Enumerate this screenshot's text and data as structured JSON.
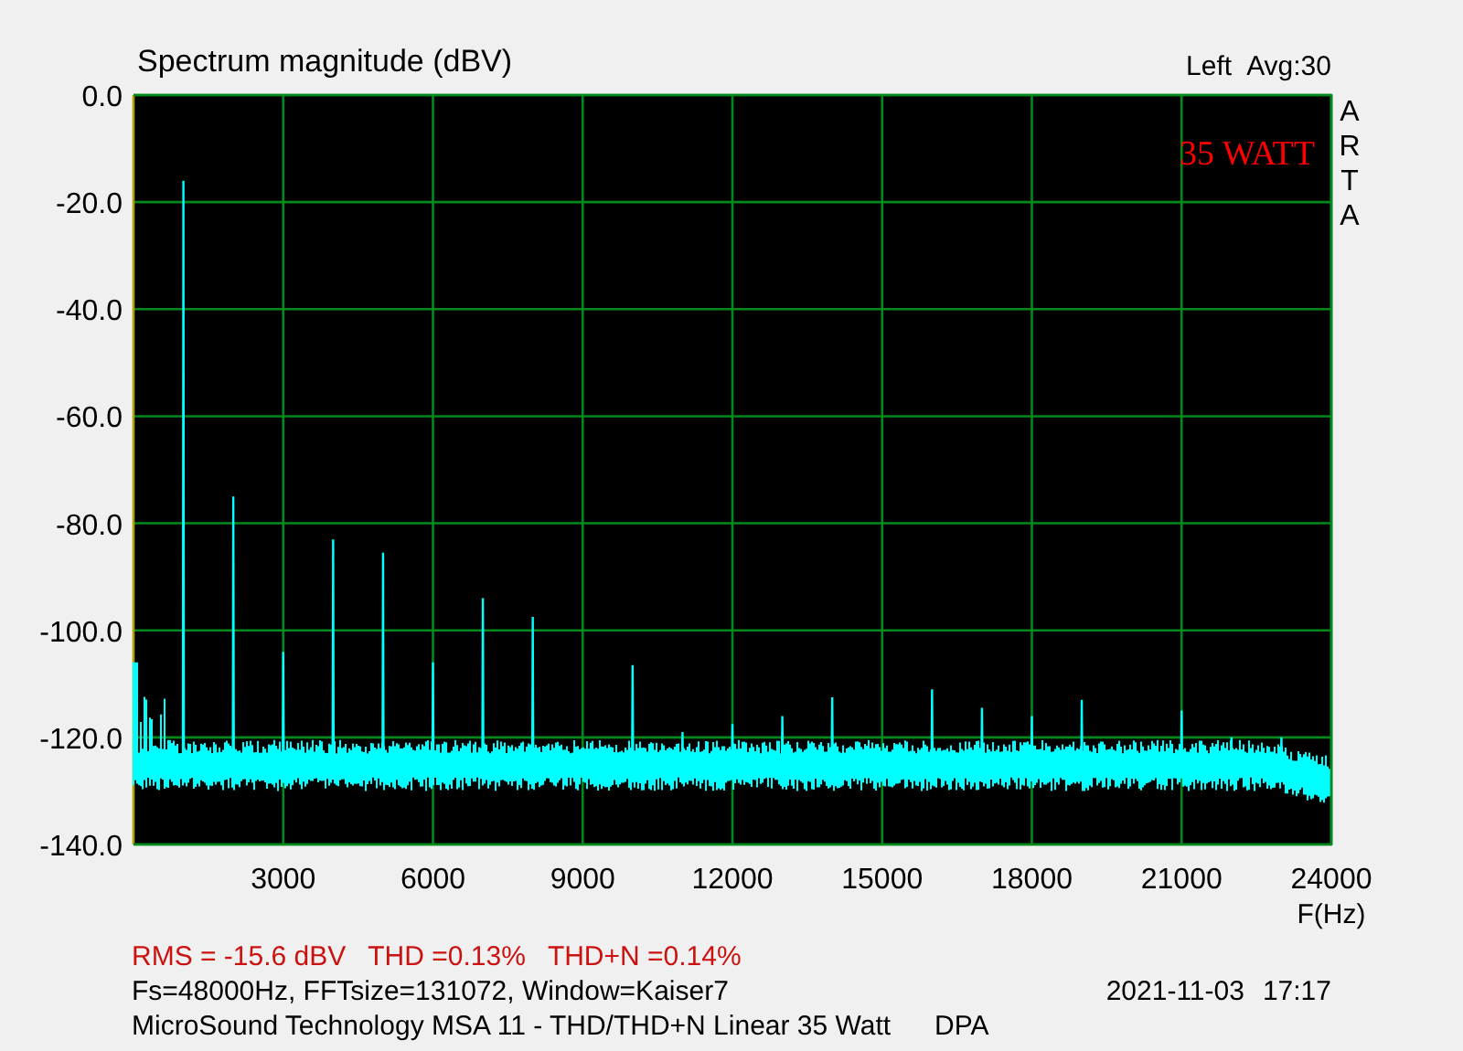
{
  "header": {
    "title": "Spectrum magnitude (dBV)",
    "averaging": "Avg:30"
  },
  "logo": "ARTA",
  "plot": {
    "overlay_label": "35 WATT",
    "chart_data": {
      "type": "line",
      "grid": true,
      "xlabel": "F(Hz)",
      "xlim": [
        0,
        24000
      ],
      "ylim": [
        -140,
        0
      ],
      "xticks": [
        3000,
        6000,
        9000,
        12000,
        15000,
        18000,
        21000,
        24000
      ],
      "yticks": [
        {
          "value": 0,
          "label": "0.0"
        },
        {
          "value": -20,
          "label": "-20.0"
        },
        {
          "value": -40,
          "label": "-40.0"
        },
        {
          "value": -60,
          "label": "-60.0"
        },
        {
          "value": -80,
          "label": "-80.0"
        },
        {
          "value": -100,
          "label": "-100.0"
        },
        {
          "value": -120,
          "label": "-120.0"
        },
        {
          "value": -140,
          "label": "-140.0"
        }
      ],
      "x": [
        990,
        1000,
        1010,
        1990,
        2000,
        2010,
        2990,
        3000,
        3010,
        3990,
        4000,
        4010,
        4990,
        5000,
        5010,
        5990,
        6000,
        6010,
        6990,
        7000,
        7010,
        7990,
        8000,
        8010,
        9990,
        10000,
        10010,
        10990,
        11000,
        11010,
        11990,
        12000,
        12010,
        12990,
        13000,
        13010,
        13990,
        14000,
        14010,
        15990,
        16000,
        16010,
        16990,
        17000,
        17010,
        17990,
        18000,
        18010,
        18990,
        19000,
        19010,
        20990,
        21000,
        21010,
        21990,
        22000,
        22010,
        22990,
        23000,
        23010
      ],
      "series": [
        {
          "name": "Left",
          "color": "#00ffff",
          "values": [
            -125,
            -16,
            -125,
            -125,
            -75,
            -125,
            -125,
            -104,
            -125,
            -125,
            -83,
            -125,
            -125,
            -85.5,
            -125,
            -125,
            -106,
            -125,
            -125,
            -94,
            -125,
            -125,
            -97.5,
            -125,
            -125,
            -106.5,
            -125,
            -125,
            -119,
            -125,
            -125,
            -117.5,
            -125,
            -125,
            -116,
            -125,
            -125,
            -112.5,
            -125,
            -125,
            -111,
            -125,
            -125,
            -114.5,
            -125,
            -125,
            -116,
            -125,
            -125,
            -113,
            -125,
            -125,
            -115,
            -125,
            -125,
            -120,
            -125,
            -125,
            -120,
            -125
          ]
        }
      ]
    }
  },
  "results": [
    "RMS =  -15.6 dBV",
    "THD =0.13%",
    "THD+N =0.14%"
  ],
  "settings": "Fs=48000Hz, FFTsize=131072, Window=Kaiser7",
  "date": "2021-11-03",
  "time": "17:17",
  "description": "MicroSound Technology MSA 11 - THD/THD+N Linear 35 Watt",
  "tag": "DPA"
}
